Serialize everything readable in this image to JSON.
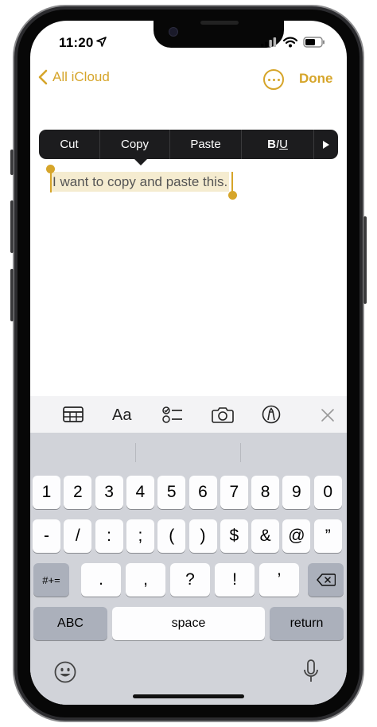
{
  "status_bar": {
    "time": "11:20"
  },
  "nav": {
    "back_label": "All iCloud",
    "done_label": "Done"
  },
  "context_menu": {
    "cut": "Cut",
    "copy": "Copy",
    "paste": "Paste",
    "format": {
      "bold": "B",
      "italic": "I",
      "underline": "U"
    }
  },
  "note": {
    "text": "I want to copy and paste this."
  },
  "toolbar_icons": [
    "table-icon",
    "text-format-icon",
    "checklist-icon",
    "camera-icon",
    "markup-pen-icon",
    "close-icon"
  ],
  "toolbar": {
    "format_label": "Aa"
  },
  "keyboard": {
    "row1": [
      "1",
      "2",
      "3",
      "4",
      "5",
      "6",
      "7",
      "8",
      "9",
      "0"
    ],
    "row2": [
      "-",
      "/",
      ":",
      ";",
      "(",
      ")",
      "$",
      "&",
      "@",
      "”"
    ],
    "row3": {
      "symbols": "#+=",
      "keys": [
        ".",
        ",",
        "?",
        "!",
        "’"
      ]
    },
    "row4": {
      "abc": "ABC",
      "space": "space",
      "return": "return"
    }
  },
  "colors": {
    "accent": "#d6a52a",
    "menu_bg": "#1c1c1e",
    "selection": "#f5ecd0",
    "keyboard_bg": "#d1d3d9"
  }
}
